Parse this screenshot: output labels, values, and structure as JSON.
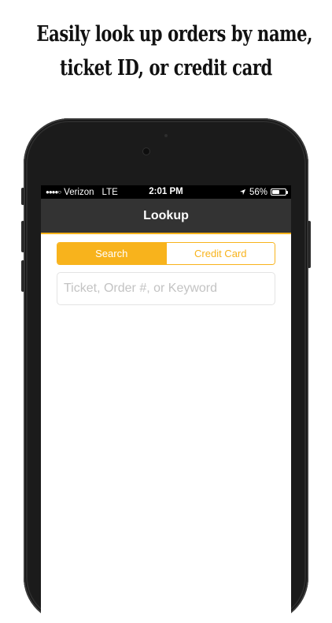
{
  "headline": {
    "line1": "Easily look up orders by name,",
    "line2": "ticket ID, or credit card"
  },
  "status_bar": {
    "signal_dots": "●●●●○",
    "carrier": "Verizon",
    "network": "LTE",
    "time": "2:01 PM",
    "location_icon": "location-arrow-icon",
    "battery_percent": "56%",
    "battery_level": 0.56
  },
  "nav": {
    "title": "Lookup"
  },
  "segmented_control": {
    "options": [
      "Search",
      "Credit Card"
    ],
    "selected": "Search"
  },
  "search": {
    "value": "",
    "placeholder": "Ticket, Order #, or Keyword"
  },
  "colors": {
    "accent": "#f8b31c",
    "navbar": "#333333",
    "status_bar": "#000000",
    "phone_body": "#1b1b1b"
  }
}
